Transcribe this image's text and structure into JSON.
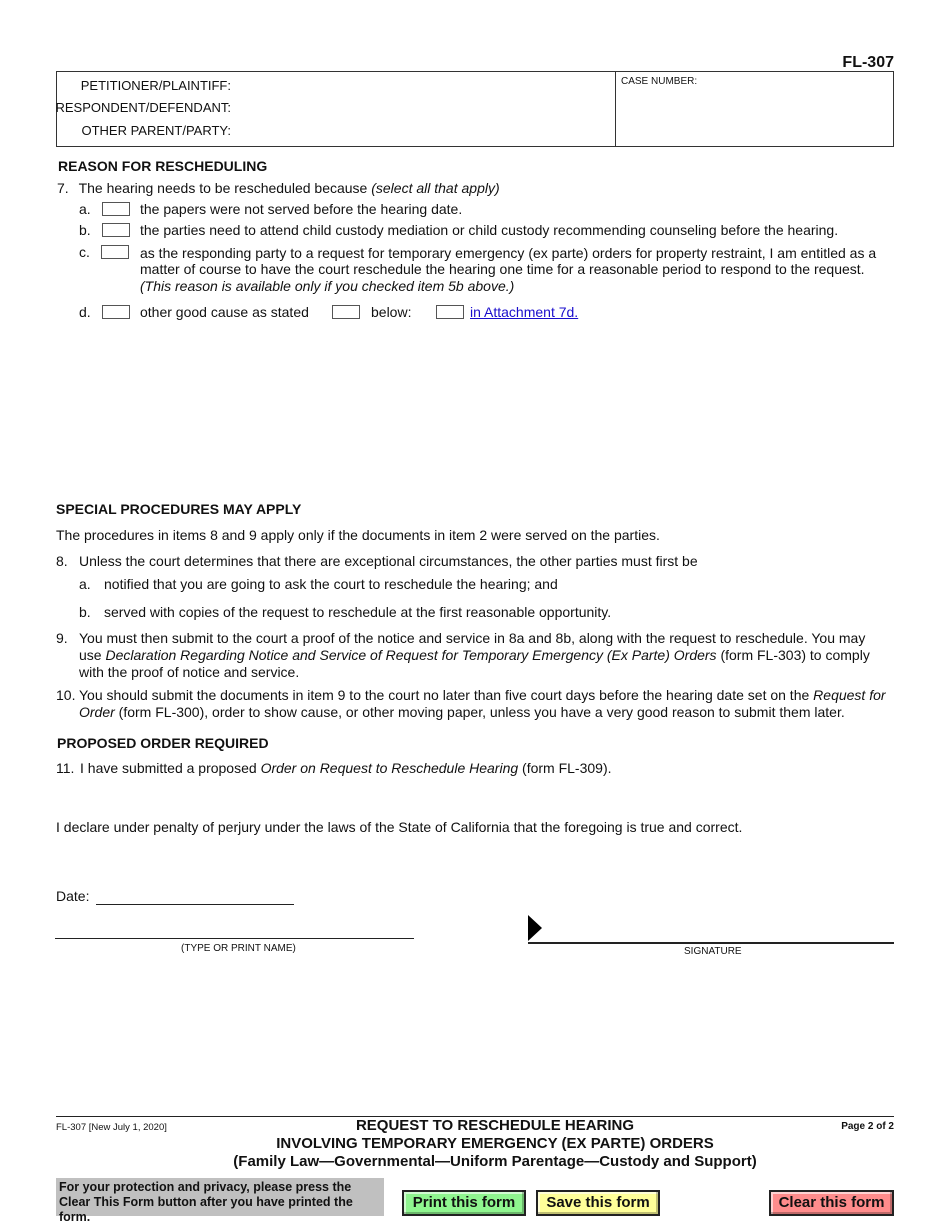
{
  "form_id": "FL-307",
  "caption": {
    "petitioner_label": "PETITIONER/PLAINTIFF:",
    "respondent_label": "RESPONDENT/DEFENDANT:",
    "other_party_label": "OTHER PARENT/PARTY:",
    "case_number_label": "CASE NUMBER:"
  },
  "reason_section": {
    "heading": "REASON FOR RESCHEDULING",
    "item7": {
      "number": "7.",
      "text": "The hearing needs to be rescheduled because ",
      "text_italic": "(select all that apply)",
      "options": [
        {
          "letter": "a.",
          "text": "the papers were not served before the hearing date.",
          "checked": false
        },
        {
          "letter": "b.",
          "text": "the parties need to attend child custody mediation or child custody recommending counseling before the hearing.",
          "checked": false
        },
        {
          "letter": "c.",
          "line1": "as the responding party to a request for temporary emergency (ex parte) orders for property restraint, I am entitled as a",
          "line2": "matter of course to have the court reschedule the hearing one time for a reasonable period to respond to the request.",
          "line3_italic": "(This reason is available only if you checked item 5b above.)",
          "checked": false
        },
        {
          "letter": "d.",
          "text": "other good cause as stated",
          "checked": false,
          "below_label": "below:",
          "below_checked": false,
          "attachment_link": "in Attachment 7d.",
          "attachment_checked": false
        }
      ]
    }
  },
  "special_section": {
    "heading": "SPECIAL PROCEDURES MAY APPLY",
    "intro": "The procedures in items 8 and 9 apply only if the documents in item 2 were served on the parties.",
    "item8": {
      "number": "8.",
      "text": "Unless the court determines that there are exceptional circumstances, the other parties must first be",
      "a_letter": "a.",
      "a_text": "notified that you are going to ask the court to reschedule the hearing; and",
      "b_letter": "b.",
      "b_text": "served with copies of the request to reschedule at the first reasonable opportunity."
    },
    "item9": {
      "number": "9.",
      "line1": "You must then submit to the court a proof of the notice and service in 8a and 8b, along with the request to reschedule. You may",
      "line2_pre": "use ",
      "line2_italic": "Declaration Regarding Notice and Service of Request for Temporary Emergency (Ex Parte) Orders",
      "line2_post": " (form FL-303) to comply",
      "line3": "with the proof of notice and service."
    },
    "item10": {
      "number": "10.",
      "line1_pre": "You should submit the documents in item 9 to the court no later than five court days before the hearing date set on the ",
      "line1_italic": "Request for",
      "line2_italic": "Order",
      "line2_post": " (form FL-300), order to show cause, or other moving paper, unless you have a very good reason to submit them later."
    }
  },
  "proposed_order_section": {
    "heading": "PROPOSED ORDER REQUIRED",
    "item11": {
      "number": "11.",
      "pre": "I have submitted a proposed ",
      "italic": "Order on Request to Reschedule Hearing",
      "post": " (form FL-309)."
    }
  },
  "declaration": "I declare under penalty of perjury under the laws of the State of California that the foregoing is true and correct.",
  "signature_block": {
    "date_label": "Date:",
    "name_caption": "(TYPE OR PRINT NAME)",
    "signature_caption": "SIGNATURE"
  },
  "footer": {
    "revision": "FL-307 [New July 1, 2020]",
    "title_line1": "REQUEST TO RESCHEDULE HEARING",
    "title_line2": "INVOLVING TEMPORARY EMERGENCY (EX PARTE) ORDERS",
    "title_line3": "(Family Law—Governmental—Uniform Parentage—Custody and Support)",
    "page": "Page 2 of 2",
    "privacy_notice": "For your protection and privacy, please press the Clear This Form button after you have printed the form."
  },
  "buttons": {
    "print": "Print this form",
    "save": "Save this form",
    "clear": "Clear this form"
  },
  "colors": {
    "print_button": "#8ff58f",
    "save_button": "#ffff99",
    "clear_button": "#ff8c8c",
    "privacy_bg": "#c0c0c0",
    "link": "#1a0dcc"
  }
}
